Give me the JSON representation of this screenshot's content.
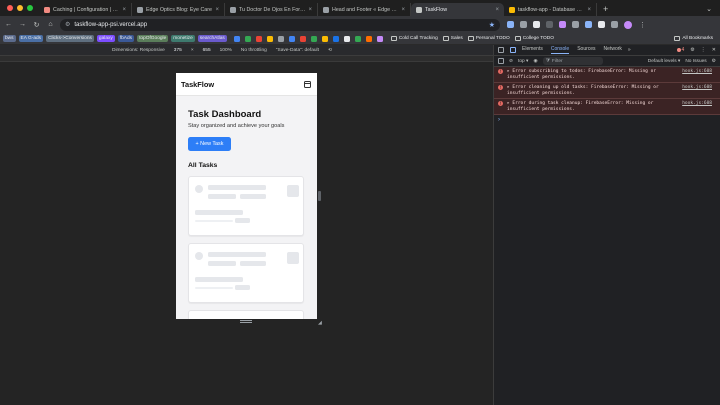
{
  "browser": {
    "tabs": [
      {
        "title": "Caching | Configuration | ect",
        "color": "#f28b82",
        "active": false
      },
      {
        "title": "Edge Optics Blog: Eye Care",
        "color": "#9aa0a6",
        "active": false
      },
      {
        "title": "Tu Doctor De Ojos En Fort Co",
        "color": "#9aa0a6",
        "active": false
      },
      {
        "title": "Head and Footer « Edge Optic",
        "color": "#9aa0a6",
        "active": false
      },
      {
        "title": "TaskFlow",
        "color": "#c4c7c5",
        "active": true
      },
      {
        "title": "taskflow-app - Database – Fi",
        "color": "#fbbc04",
        "active": false
      }
    ],
    "url": "taskflow-app-psi.vercel.app",
    "bookmarks": [
      {
        "label": "bws",
        "bg": "#5b6b8c"
      },
      {
        "label": "EA G-ads",
        "bg": "#4a6fa5"
      },
      {
        "label": "Clicks->Conversions",
        "bg": "#5f6f7f"
      },
      {
        "label": "galaxy",
        "bg": "#7c4dff"
      },
      {
        "label": "fbAds",
        "bg": "#3b5998"
      },
      {
        "label": "topOfGoogle",
        "bg": "#5a7d5a"
      },
      {
        "label": "monetize",
        "bg": "#3e7a6e"
      },
      {
        "label": "searchAtlas",
        "bg": "#6a5acd"
      }
    ],
    "bookmark_icon_colors": [
      "#4285f4",
      "#34a853",
      "#ea4335",
      "#fbbc04",
      "#9aa0a6",
      "#4285f4",
      "#ea4335",
      "#34a853",
      "#fbbc04",
      "#1a73e8",
      "#e8eaed",
      "#34a853",
      "#ff6d00",
      "#c58af9"
    ],
    "bookmark_folders": [
      "Cold Call Tracking",
      "Sales",
      "Personal TODO",
      "College TODO"
    ],
    "all_bookmarks": "All Bookmarks"
  },
  "device_toolbar": {
    "dimensions": "Dimensions: Responsive",
    "width": "375",
    "height": "655",
    "zoom": "100%",
    "throttling": "No throttling",
    "save_data": "\"Save-Data\": default"
  },
  "app": {
    "brand": "TaskFlow",
    "title": "Task Dashboard",
    "subtitle": "Stay organized and achieve your goals",
    "new_task": "+ New Task",
    "section": "All Tasks",
    "skeleton_cards": 3
  },
  "devtools": {
    "tabs": [
      "Elements",
      "Console",
      "Sources",
      "Network"
    ],
    "active_tab": "Console",
    "more_tabs": "»",
    "error_count": "4",
    "context": "top",
    "filter_placeholder": "Filter",
    "levels": "Default levels",
    "issues": "No Issues",
    "messages": [
      {
        "text": "▸ Error subscribing to todos: FirebaseError: Missing or insufficient permissions.",
        "source": "hook.js:608"
      },
      {
        "text": "▸ Error cleaning up old tasks: FirebaseError: Missing or insufficient permissions.",
        "source": "hook.js:608"
      },
      {
        "text": "▸ Error during task cleanup: FirebaseError: Missing or insufficient permissions.",
        "source": "hook.js:608"
      }
    ],
    "prompt": "›"
  },
  "colors": {
    "accent": "#2d7ef7",
    "traffic": [
      "#ff5f57",
      "#febc2e",
      "#28c840"
    ]
  }
}
